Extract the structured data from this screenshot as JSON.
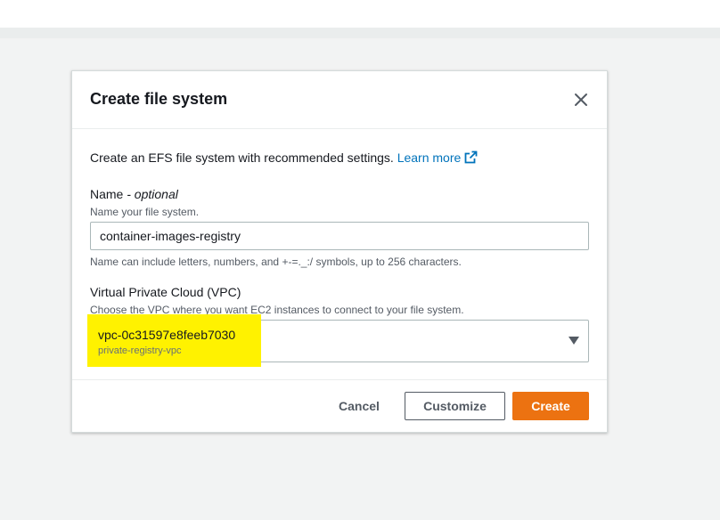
{
  "modal": {
    "title": "Create file system",
    "intro_text": "Create an EFS file system with recommended settings.",
    "learn_more": "Learn more",
    "name_field": {
      "label": "Name",
      "optional": "- optional",
      "description": "Name your file system.",
      "value": "container-images-registry",
      "hint": "Name can include letters, numbers, and +-=._:/ symbols, up to 256 characters."
    },
    "vpc_field": {
      "label": "Virtual Private Cloud (VPC)",
      "description": "Choose the VPC where you want EC2 instances to connect to your file system.",
      "selected_value": "vpc-0c31597e8feeb7030",
      "selected_sub": "private-registry-vpc"
    },
    "footer": {
      "cancel_label": "Cancel",
      "customize_label": "Customize",
      "create_label": "Create"
    }
  },
  "colors": {
    "accent": "#ec7211",
    "link": "#0073bb",
    "highlight": "#fff200"
  }
}
